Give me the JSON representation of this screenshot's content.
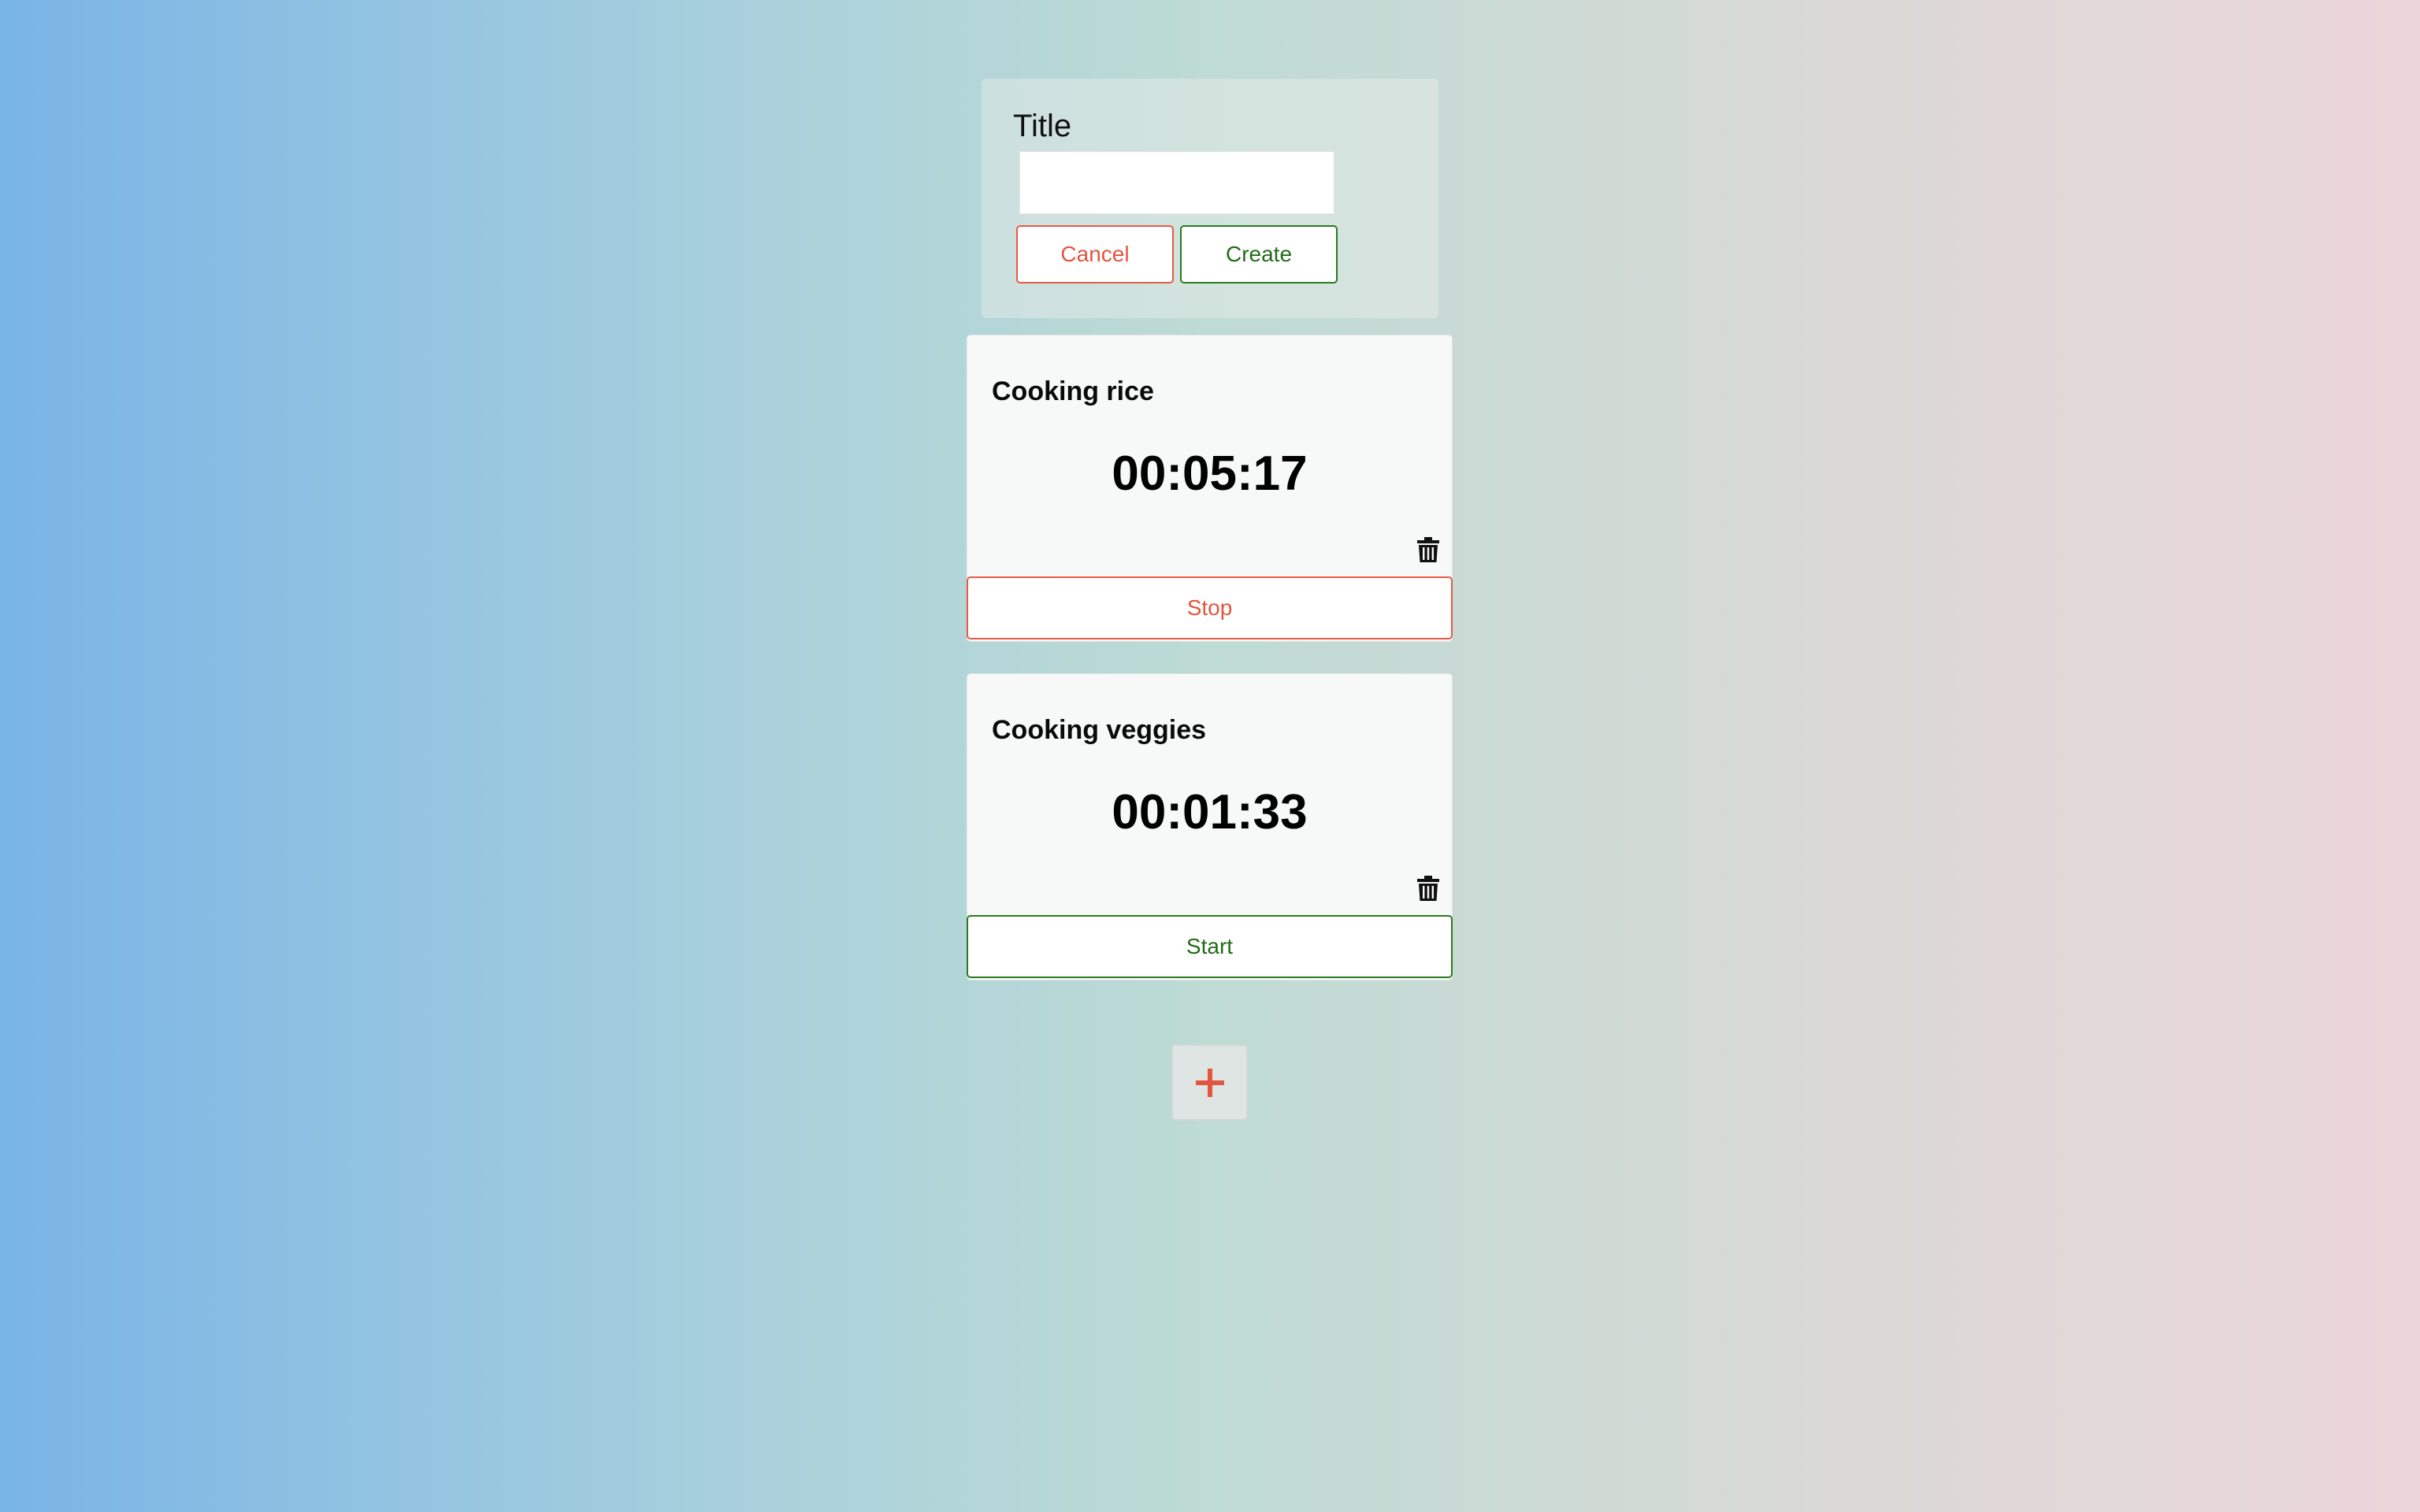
{
  "form": {
    "title_label": "Title",
    "title_value": "",
    "title_placeholder": "",
    "cancel_label": "Cancel",
    "create_label": "Create"
  },
  "timers": [
    {
      "title": "Cooking rice",
      "time": "00:05:17",
      "action_label": "Stop",
      "running": true
    },
    {
      "title": "Cooking veggies",
      "time": "00:01:33",
      "action_label": "Start",
      "running": false
    }
  ],
  "add_button": {
    "icon": "plus-icon"
  },
  "icons": {
    "delete": "trash-icon",
    "add": "plus-icon"
  },
  "colors": {
    "danger": "#e2553f",
    "success": "#236b18",
    "gradient_left": "#79b4e6",
    "gradient_mid": "#bedbd4",
    "gradient_right": "#ecd6da"
  }
}
